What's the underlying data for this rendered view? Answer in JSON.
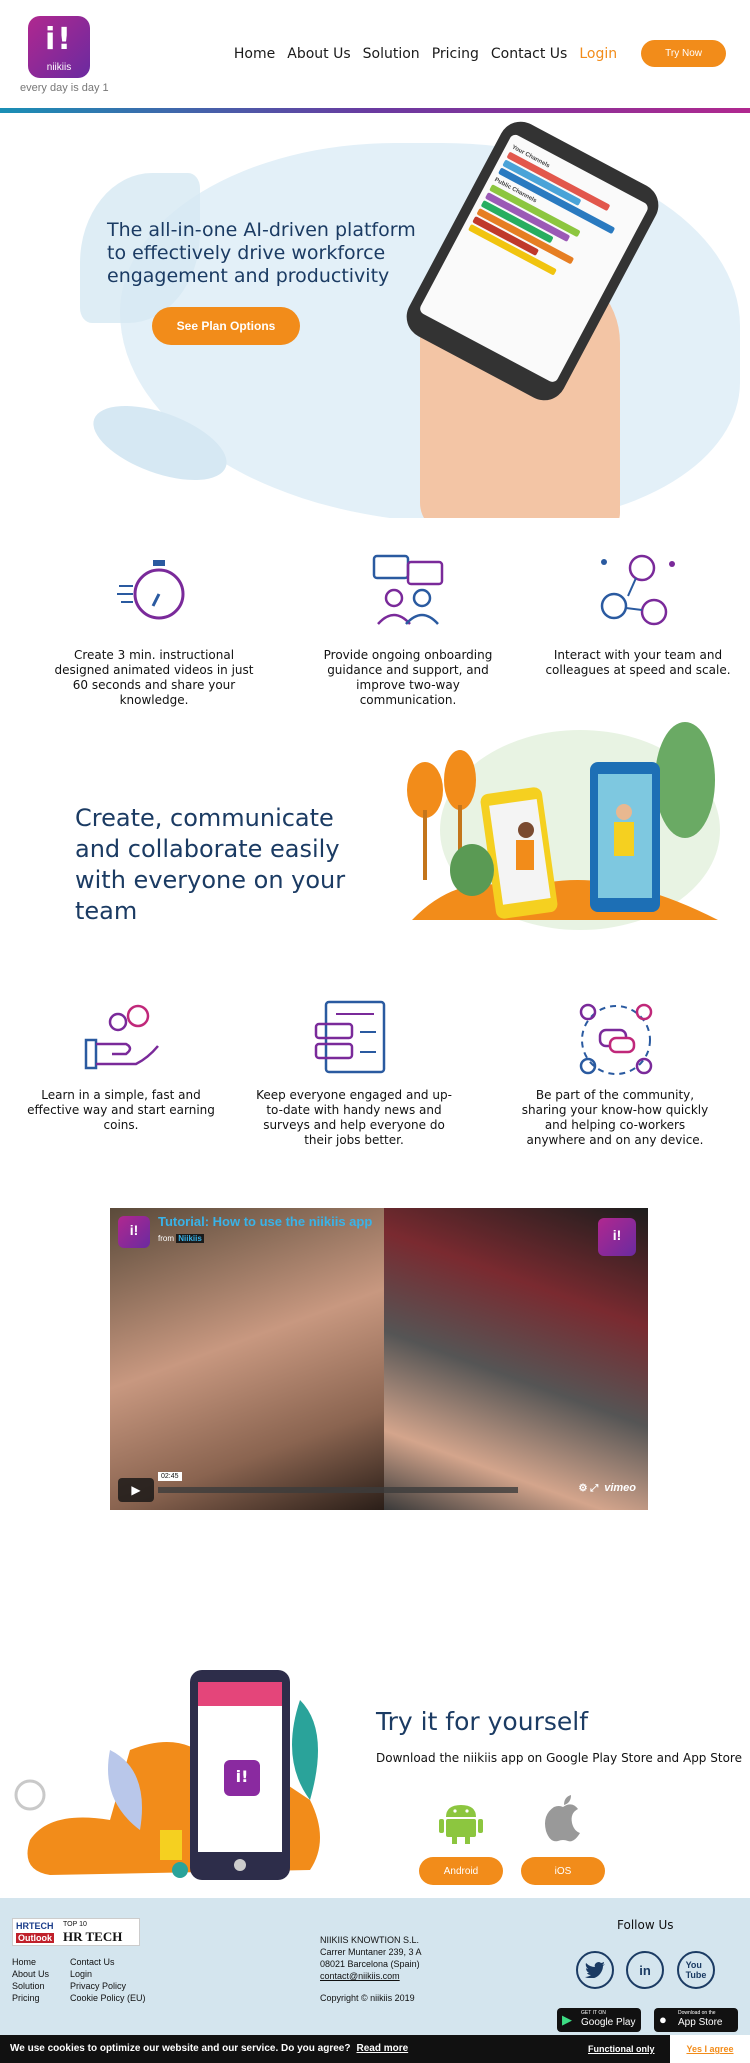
{
  "header": {
    "logo_mark": "i!",
    "logo_name": "niikiis",
    "tagline": "every day is day 1",
    "nav": [
      "Home",
      "About Us",
      "Solution",
      "Pricing",
      "Contact Us"
    ],
    "login": "Login",
    "try_now": "Try Now"
  },
  "hero": {
    "title": "The all-in-one AI-driven platform to effectively drive workforce engagement and productivity",
    "cta": "See Plan Options",
    "phone": {
      "section1": "Your Channels",
      "section2": "Public Channels"
    }
  },
  "features_row1": [
    {
      "icon": "stopwatch-icon",
      "text": "Create 3 min. instructional designed animated videos in just 60 seconds and share your knowledge."
    },
    {
      "icon": "chat-people-icon",
      "text": "Provide ongoing onboarding guidance and support, and improve two-way communication."
    },
    {
      "icon": "network-people-icon",
      "text": "Interact with your team and colleagues at speed and scale."
    }
  ],
  "collab": {
    "title": "Create, communicate and collaborate easily with everyone on your team"
  },
  "features_row2": [
    {
      "icon": "coins-hand-icon",
      "text": "Learn in a simple, fast and effective way and start earning coins."
    },
    {
      "icon": "news-survey-icon",
      "text": "Keep everyone engaged and up-to-date with handy news and surveys and help everyone do their jobs better."
    },
    {
      "icon": "community-icon",
      "text": "Be part of the community, sharing your know-how quickly and helping co-workers anywhere and on any device."
    }
  ],
  "video": {
    "title": "Tutorial: How to use the niikiis app",
    "from_label": "from",
    "from_name": "Niikiis",
    "time": "02:45",
    "brand": "vimeo"
  },
  "try_section": {
    "title": "Try it for yourself",
    "subtitle": "Download the niikiis app on Google Play Store and App Store",
    "android": "Android",
    "ios": "iOS"
  },
  "footer": {
    "badge": {
      "line1": "HRTECH",
      "line2": "Outlook",
      "line3": "TOP 10",
      "line4": "HR TECH"
    },
    "links_col1": [
      "Home",
      "About Us",
      "Solution",
      "Pricing"
    ],
    "links_col2": [
      "Contact Us",
      "Login",
      "Privacy Policy",
      "Cookie Policy (EU)"
    ],
    "company": "NIIKIIS KNOWTION S.L.",
    "address1": "Carrer Muntaner 239, 3 A",
    "address2": "08021 Barcelona (Spain)",
    "email": "contact@niikiis.com",
    "copyright": "Copyright © niikiis 2019",
    "follow": "Follow Us",
    "social": [
      "twitter-icon",
      "linkedin-icon",
      "youtube-icon"
    ],
    "google_play": {
      "small": "GET IT ON",
      "big": "Google Play"
    },
    "app_store": {
      "small": "Download on the",
      "big": "App Store"
    }
  },
  "cookie": {
    "message": "We use cookies to optimize our website and our service. Do you agree?",
    "read_more": "Read more",
    "functional": "Functional only",
    "agree": "Yes I agree"
  },
  "colors": {
    "accent": "#f28c1a",
    "brand_purple": "#8a2aa0",
    "heading": "#1b3b63",
    "footer_bg": "#d4e5ee"
  }
}
